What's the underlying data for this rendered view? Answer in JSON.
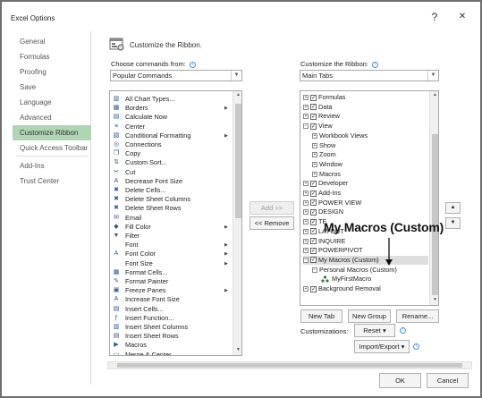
{
  "window": {
    "title": "Excel Options",
    "help_glyph": "?",
    "close_glyph": "✕"
  },
  "nav": {
    "items": [
      {
        "label": "General",
        "active": false
      },
      {
        "label": "Formulas",
        "active": false
      },
      {
        "label": "Proofing",
        "active": false
      },
      {
        "label": "Save",
        "active": false
      },
      {
        "label": "Language",
        "active": false
      },
      {
        "label": "Advanced",
        "active": false
      },
      {
        "label": "Customize Ribbon",
        "active": true
      },
      {
        "label": "Quick Access Toolbar",
        "active": false
      },
      {
        "label": "Add-Ins",
        "active": false
      },
      {
        "label": "Trust Center",
        "active": false
      }
    ],
    "active_color": "#aed6b4"
  },
  "main": {
    "heading": "Customize the Ribbon.",
    "choose_label": "Choose commands from:",
    "choose_value": "Popular Commands",
    "customize_label": "Customize the Ribbon:",
    "customize_value": "Main Tabs",
    "info_glyph": "i"
  },
  "commands": [
    {
      "label": "All Chart Types...",
      "icon": "chart-icon",
      "glyph": "▥",
      "sub": false
    },
    {
      "label": "Borders",
      "icon": "borders-icon",
      "glyph": "▦",
      "sub": true
    },
    {
      "label": "Calculate Now",
      "icon": "calculate-icon",
      "glyph": "▤",
      "sub": false
    },
    {
      "label": "Center",
      "icon": "center-align-icon",
      "glyph": "≡",
      "sub": false
    },
    {
      "label": "Conditional Formatting",
      "icon": "conditional-formatting-icon",
      "glyph": "▧",
      "sub": true
    },
    {
      "label": "Connections",
      "icon": "connections-icon",
      "glyph": "◎",
      "sub": false
    },
    {
      "label": "Copy",
      "icon": "copy-icon",
      "glyph": "❐",
      "sub": false
    },
    {
      "label": "Custom Sort...",
      "icon": "sort-icon",
      "glyph": "⇅",
      "sub": false
    },
    {
      "label": "Cut",
      "icon": "cut-icon",
      "glyph": "✂",
      "sub": false
    },
    {
      "label": "Decrease Font Size",
      "icon": "decrease-font-icon",
      "glyph": "A",
      "sub": false
    },
    {
      "label": "Delete Cells...",
      "icon": "delete-cells-icon",
      "glyph": "✖",
      "sub": false
    },
    {
      "label": "Delete Sheet Columns",
      "icon": "delete-columns-icon",
      "glyph": "✖",
      "sub": false
    },
    {
      "label": "Delete Sheet Rows",
      "icon": "delete-rows-icon",
      "glyph": "✖",
      "sub": false
    },
    {
      "label": "Email",
      "icon": "email-icon",
      "glyph": "✉",
      "sub": false
    },
    {
      "label": "Fill Color",
      "icon": "fill-color-icon",
      "glyph": "◆",
      "sub": true
    },
    {
      "label": "Filter",
      "icon": "filter-icon",
      "glyph": "▼",
      "sub": false
    },
    {
      "label": "Font",
      "icon": "font-icon",
      "glyph": "",
      "sub": true
    },
    {
      "label": "Font Color",
      "icon": "font-color-icon",
      "glyph": "A",
      "sub": true
    },
    {
      "label": "Font Size",
      "icon": "font-size-icon",
      "glyph": "",
      "sub": true
    },
    {
      "label": "Format Cells...",
      "icon": "format-cells-icon",
      "glyph": "▦",
      "sub": false
    },
    {
      "label": "Format Painter",
      "icon": "format-painter-icon",
      "glyph": "✎",
      "sub": false
    },
    {
      "label": "Freeze Panes",
      "icon": "freeze-panes-icon",
      "glyph": "▣",
      "sub": true
    },
    {
      "label": "Increase Font Size",
      "icon": "increase-font-icon",
      "glyph": "A",
      "sub": false
    },
    {
      "label": "Insert Cells...",
      "icon": "insert-cells-icon",
      "glyph": "▤",
      "sub": false
    },
    {
      "label": "Insert Function...",
      "icon": "insert-function-icon",
      "glyph": "ƒ",
      "sub": false
    },
    {
      "label": "Insert Sheet Columns",
      "icon": "insert-columns-icon",
      "glyph": "▥",
      "sub": false
    },
    {
      "label": "Insert Sheet Rows",
      "icon": "insert-rows-icon",
      "glyph": "▤",
      "sub": false
    },
    {
      "label": "Macros",
      "icon": "macros-icon",
      "glyph": "▶",
      "sub": false
    },
    {
      "label": "Merge & Center",
      "icon": "merge-center-icon",
      "glyph": "▭",
      "sub": false
    }
  ],
  "middle_buttons": {
    "add": "Add >>",
    "remove": "<< Remove"
  },
  "tree": [
    {
      "label": "Formulas",
      "level": 0,
      "expander": "⊞",
      "checked": true,
      "selected": false
    },
    {
      "label": "Data",
      "level": 0,
      "expander": "⊞",
      "checked": true,
      "selected": false
    },
    {
      "label": "Review",
      "level": 0,
      "expander": "⊞",
      "checked": true,
      "selected": false
    },
    {
      "label": "View",
      "level": 0,
      "expander": "⊟",
      "checked": true,
      "selected": false
    },
    {
      "label": "Workbook Views",
      "level": 1,
      "expander": "⊞",
      "checked": null,
      "selected": false
    },
    {
      "label": "Show",
      "level": 1,
      "expander": "⊞",
      "checked": null,
      "selected": false
    },
    {
      "label": "Zoom",
      "level": 1,
      "expander": "⊞",
      "checked": null,
      "selected": false
    },
    {
      "label": "Window",
      "level": 1,
      "expander": "⊞",
      "checked": null,
      "selected": false
    },
    {
      "label": "Macros",
      "level": 1,
      "expander": "⊞",
      "checked": null,
      "selected": false
    },
    {
      "label": "Developer",
      "level": 0,
      "expander": "⊞",
      "checked": true,
      "selected": false
    },
    {
      "label": "Add-Ins",
      "level": 0,
      "expander": "⊞",
      "checked": true,
      "selected": false
    },
    {
      "label": "POWER VIEW",
      "level": 0,
      "expander": "⊞",
      "checked": true,
      "selected": false
    },
    {
      "label": "DESIGN",
      "level": 0,
      "expander": "⊞",
      "checked": true,
      "selected": false
    },
    {
      "label": "TE",
      "level": 0,
      "expander": "⊞",
      "checked": true,
      "selected": false
    },
    {
      "label": "LAYOUT",
      "level": 0,
      "expander": "⊞",
      "checked": true,
      "selected": false
    },
    {
      "label": "INQUIRE",
      "level": 0,
      "expander": "⊞",
      "checked": true,
      "selected": false
    },
    {
      "label": "POWERPIVOT",
      "level": 0,
      "expander": "⊞",
      "checked": true,
      "selected": false
    },
    {
      "label": "My Macros (Custom)",
      "level": 0,
      "expander": "⊟",
      "checked": true,
      "selected": true
    },
    {
      "label": "Personal Macros (Custom)",
      "level": 1,
      "expander": "⊟",
      "checked": null,
      "selected": false
    },
    {
      "label": "MyFirstMacro",
      "level": 2,
      "expander": "",
      "checked": null,
      "selected": false
    },
    {
      "label": "Background Removal",
      "level": 0,
      "expander": "⊞",
      "checked": true,
      "selected": false
    }
  ],
  "tree_buttons": {
    "new_tab": "New Tab",
    "new_group": "New Group",
    "rename": "Rename..."
  },
  "customizations": {
    "label": "Customizations:",
    "reset": "Reset ▾",
    "import_export": "Import/Export ▾"
  },
  "callout": {
    "text": "My Macros (Custom)"
  },
  "footer": {
    "ok": "OK",
    "cancel": "Cancel"
  }
}
